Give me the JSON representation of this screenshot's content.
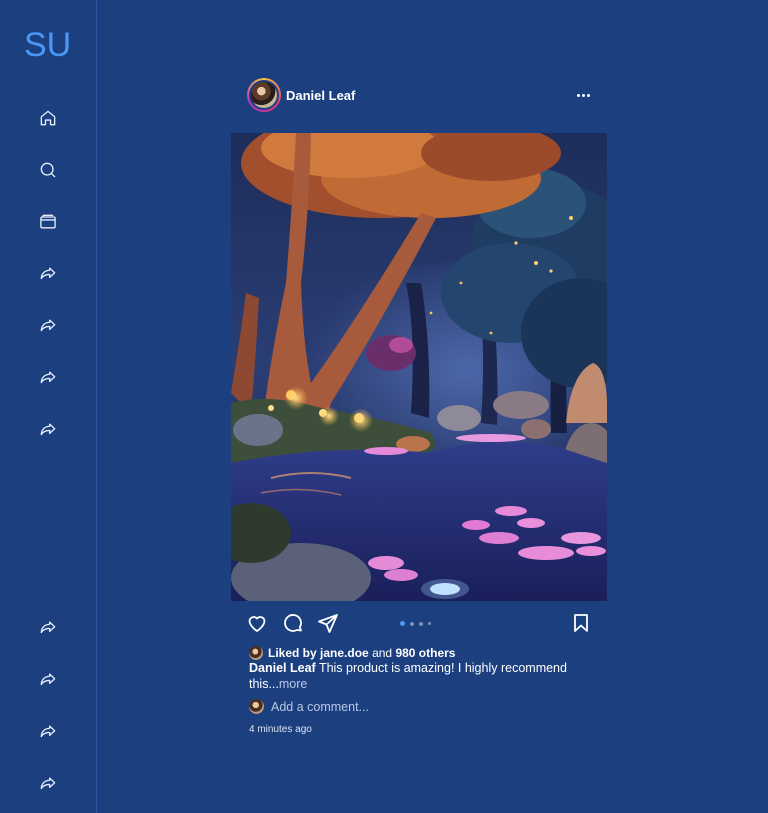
{
  "sidebar": {
    "logo": "SU",
    "top_items": [
      {
        "icon": "home-icon"
      },
      {
        "icon": "search-icon"
      },
      {
        "icon": "wallet-icon"
      },
      {
        "icon": "share-icon"
      },
      {
        "icon": "share-icon"
      },
      {
        "icon": "share-icon"
      },
      {
        "icon": "share-icon"
      }
    ],
    "bottom_items": [
      {
        "icon": "share-icon"
      },
      {
        "icon": "share-icon"
      },
      {
        "icon": "share-icon"
      },
      {
        "icon": "share-icon"
      }
    ]
  },
  "post": {
    "username": "Daniel Leaf",
    "likes": {
      "prefix": "Liked by",
      "user": "jane.doe",
      "joiner": "and",
      "others": "980 others"
    },
    "caption": {
      "author": "Daniel Leaf",
      "text": "This product is amazing! I highly recommend this...",
      "more": "more"
    },
    "comment_placeholder": "Add a comment...",
    "time": "4 minutes ago",
    "carousel": {
      "count": 4,
      "active": 0
    }
  },
  "colors": {
    "background": "#1c3f80",
    "accent": "#4a98f4"
  }
}
